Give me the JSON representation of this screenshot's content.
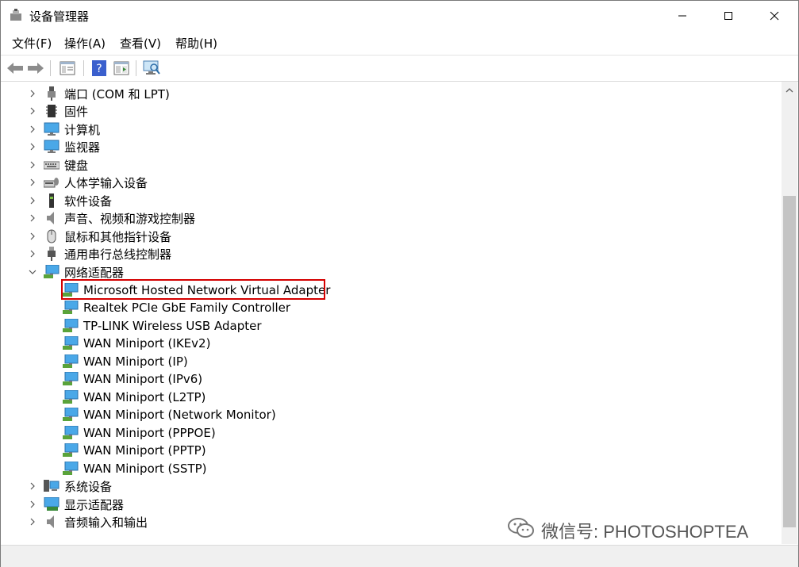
{
  "window": {
    "title": "设备管理器"
  },
  "menu": [
    "文件(F)",
    "操作(A)",
    "查看(V)",
    "帮助(H)"
  ],
  "toolbar": [
    "back-icon",
    "forward-icon",
    "properties-icon",
    "help-icon",
    "show-hide-icon",
    "scan-hardware-icon"
  ],
  "tree": {
    "categories_top": [
      {
        "label": "端口 (COM 和 LPT)",
        "icon": "port-icon"
      },
      {
        "label": "固件",
        "icon": "firmware-icon"
      },
      {
        "label": "计算机",
        "icon": "computer-icon"
      },
      {
        "label": "监视器",
        "icon": "monitor-icon"
      },
      {
        "label": "键盘",
        "icon": "keyboard-icon"
      },
      {
        "label": "人体学输入设备",
        "icon": "hid-icon"
      },
      {
        "label": "软件设备",
        "icon": "software-device-icon"
      },
      {
        "label": "声音、视频和游戏控制器",
        "icon": "speaker-icon"
      },
      {
        "label": "鼠标和其他指针设备",
        "icon": "mouse-icon"
      },
      {
        "label": "通用串行总线控制器",
        "icon": "usb-icon"
      }
    ],
    "network": {
      "label": "网络适配器",
      "expanded": true,
      "children": [
        "Microsoft Hosted Network Virtual Adapter",
        "Realtek PCIe GbE Family Controller",
        "TP-LINK Wireless USB Adapter",
        "WAN Miniport (IKEv2)",
        "WAN Miniport (IP)",
        "WAN Miniport (IPv6)",
        "WAN Miniport (L2TP)",
        "WAN Miniport (Network Monitor)",
        "WAN Miniport (PPPOE)",
        "WAN Miniport (PPTP)",
        "WAN Miniport (SSTP)"
      ]
    },
    "categories_bottom": [
      {
        "label": "系统设备",
        "icon": "system-device-icon"
      },
      {
        "label": "显示适配器",
        "icon": "display-adapter-icon"
      },
      {
        "label": "音频输入和输出",
        "icon": "audio-io-icon"
      }
    ]
  },
  "watermark": "微信号: PHOTOSHOPTEA"
}
